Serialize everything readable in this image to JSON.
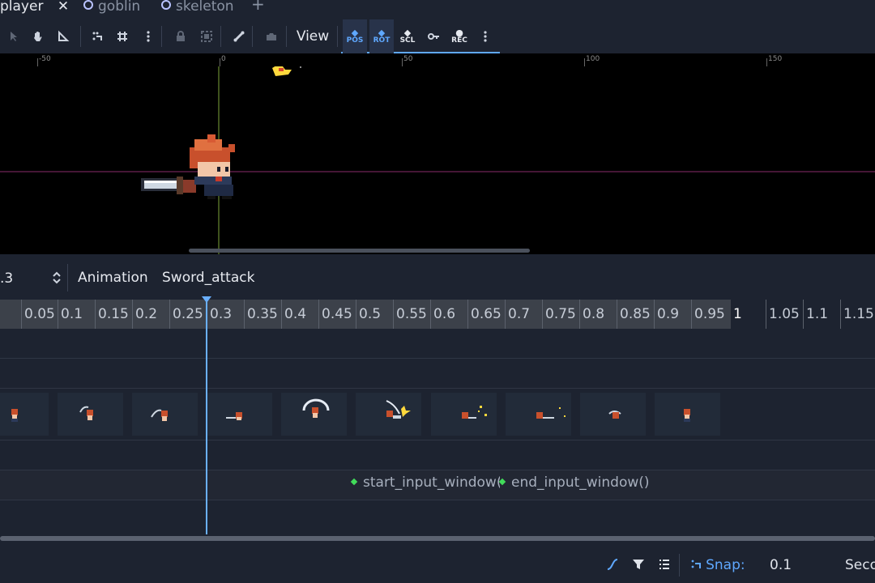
{
  "tabs": [
    {
      "label": "player",
      "active": true,
      "close": "✕"
    },
    {
      "label": "goblin",
      "active": false
    },
    {
      "label": "skeleton",
      "active": false
    }
  ],
  "tab_add": "+",
  "toolbar": {
    "view_label": "View",
    "key_buttons": [
      "POS",
      "ROT",
      "SCL"
    ]
  },
  "ruler": {
    "labels": [
      "-50",
      "0",
      "50",
      "100",
      "150"
    ]
  },
  "anim": {
    "length_value": ".3",
    "animation_label": "Animation",
    "animation_name": "Sword_attack"
  },
  "timeline": {
    "ticks": [
      "0.05",
      "0.1",
      "0.15",
      "0.2",
      "0.25",
      "0.3",
      "0.35",
      "0.4",
      "0.45",
      "0.5",
      "0.55",
      "0.6",
      "0.65",
      "0.7",
      "0.75",
      "0.8",
      "0.85",
      "0.9",
      "0.95",
      "1",
      "1.05",
      "1.1",
      "1.15"
    ],
    "playhead_time": 0.28,
    "animation_length": 1.0
  },
  "method_keys": [
    "start_input_window()",
    "end_input_window()"
  ],
  "footer": {
    "snap_label": "Snap:",
    "snap_value": "0.1",
    "snap_unit": "Seconds"
  },
  "colors": {
    "accent": "#5fa8ff",
    "background": "#1d2330",
    "viewport": "#000000",
    "method_key": "#41dc5a"
  }
}
